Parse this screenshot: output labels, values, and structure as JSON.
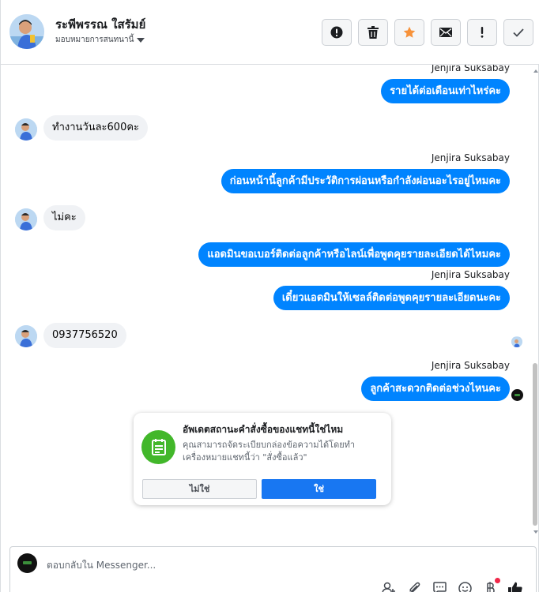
{
  "header": {
    "contact_name": "ระพีพรรณ ใสรัมย์",
    "assign_label": "มอบหมายการสนทนานี้"
  },
  "actions": [
    {
      "name": "spam-button",
      "icon": "alert-circle-icon"
    },
    {
      "name": "delete-button",
      "icon": "trash-icon"
    },
    {
      "name": "star-button",
      "icon": "star-icon",
      "color": "#f7923a"
    },
    {
      "name": "mark-unread-button",
      "icon": "envelope-icon"
    },
    {
      "name": "follow-up-button",
      "icon": "exclamation-icon"
    },
    {
      "name": "mark-done-button",
      "icon": "check-icon"
    }
  ],
  "messages": [
    {
      "direction": "out",
      "sender": "Jenjira Suksabay",
      "text": "รายได้ต่อเดือนเท่าไหร่คะ"
    },
    {
      "direction": "in",
      "text": "ทำงานวันละ600คะ"
    },
    {
      "direction": "out",
      "sender": "Jenjira Suksabay",
      "text": "ก่อนหน้านี้ลูกค้ามีประวัติการผ่อนหรือกำลังผ่อนอะไรอยู่ไหมคะ"
    },
    {
      "direction": "in",
      "text": "ไม่คะ"
    },
    {
      "direction": "out",
      "sender": "",
      "text": "แอดมินขอเบอร์ติดต่อลูกค้าหรือไลน์เพื่อพูดคุยรายละเอียดได้ไหมคะ"
    },
    {
      "direction": "out",
      "sender": "Jenjira Suksabay",
      "text": "เดี๋ยวแอดมินให้เซลล์ติดต่อพูดคุยรายละเอียดนะคะ"
    },
    {
      "direction": "in",
      "text": "0937756520"
    },
    {
      "direction": "out",
      "sender": "Jenjira Suksabay",
      "text": "ลูกค้าสะดวกติดต่อช่วงไหนคะ"
    }
  ],
  "order_card": {
    "title": "อัพเดตสถานะคำสั่งซื้อของแชทนี้ใช่ไหม",
    "description": "คุณสามารถจัดระเบียบกล่องข้อความได้โดยทำเครื่องหมายแชทนี้ว่า \"สั่งซื้อแล้ว\"",
    "no_label": "ไม่ใช่",
    "yes_label": "ใช่",
    "icon": "order-receipt-icon",
    "icon_color": "#42b72a"
  },
  "composer": {
    "placeholder": "ตอบกลับใน Messenger...",
    "tools": [
      "saved-reply-icon",
      "attachment-icon",
      "quick-reply-icon",
      "emoji-icon",
      "payment-icon",
      "like-icon"
    ]
  },
  "colors": {
    "outgoing_bubble": "#0084ff",
    "incoming_bubble": "#f0f2f5",
    "primary_button": "#1877f2"
  }
}
